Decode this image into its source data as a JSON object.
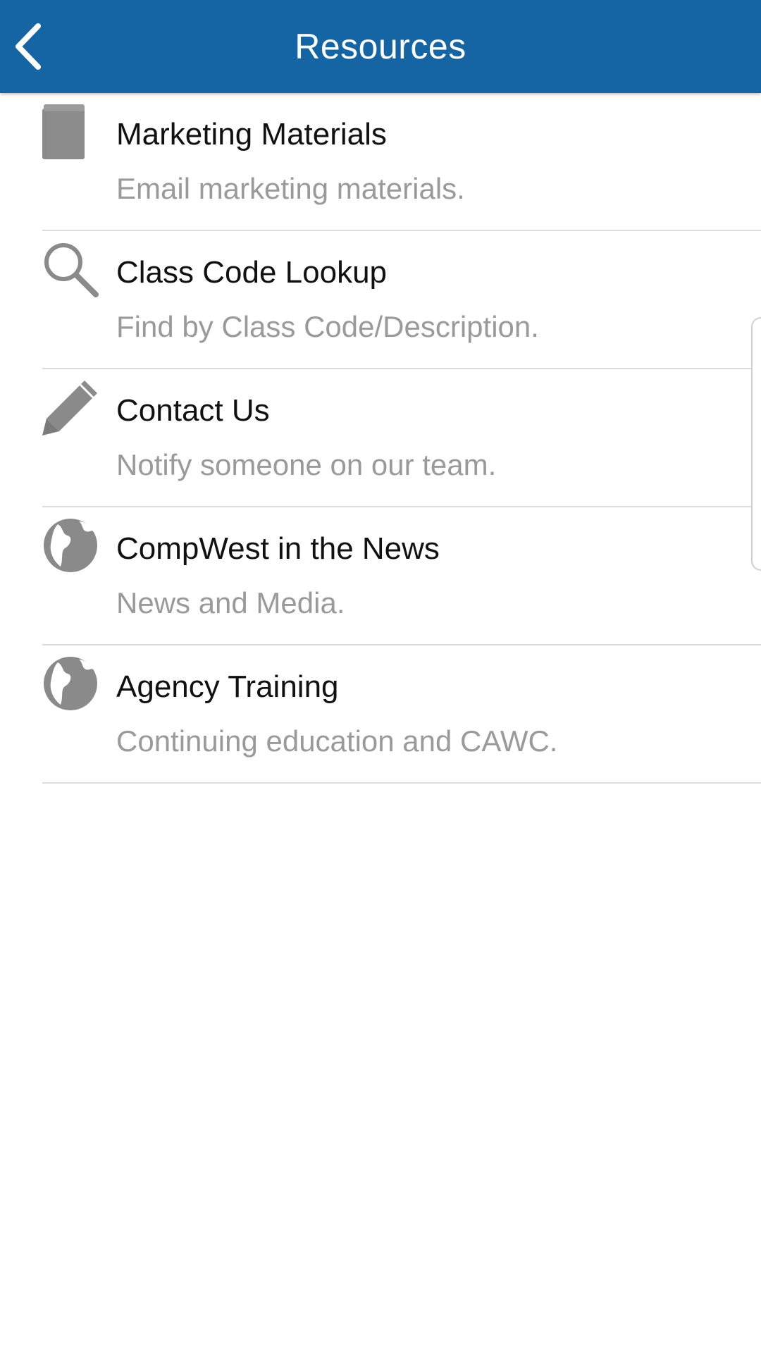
{
  "header": {
    "title": "Resources",
    "back_icon": "chevron-left-icon",
    "background_color": "#1565a5"
  },
  "resources": [
    {
      "title": "Marketing Materials",
      "subtitle": "Email marketing materials.",
      "icon": "book-icon"
    },
    {
      "title": "Class Code Lookup",
      "subtitle": "Find by Class Code/Description.",
      "icon": "search-icon"
    },
    {
      "title": "Contact Us",
      "subtitle": "Notify someone on our team.",
      "icon": "pencil-icon"
    },
    {
      "title": "CompWest in the News",
      "subtitle": "News and Media.",
      "icon": "globe-icon"
    },
    {
      "title": "Agency Training",
      "subtitle": "Continuing education and CAWC.",
      "icon": "globe-icon"
    }
  ]
}
